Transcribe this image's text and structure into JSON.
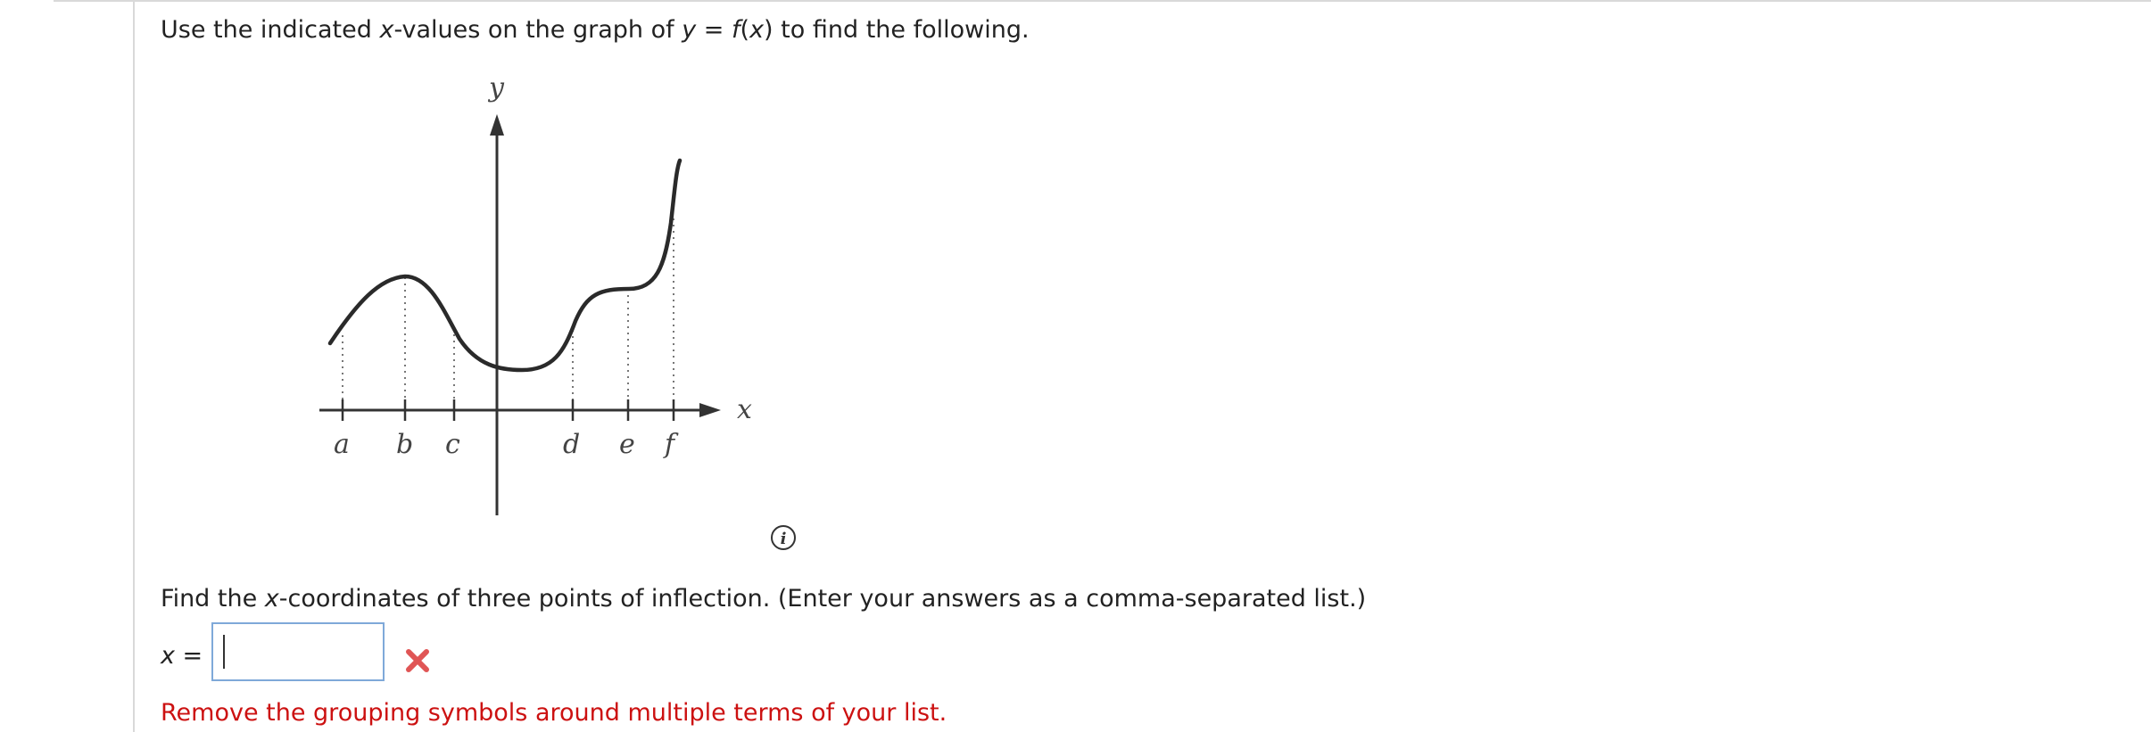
{
  "question": {
    "p1": "Use the indicated ",
    "x": "x",
    "p2": "-values on the graph of ",
    "y": "y",
    "eq": " = ",
    "f": "f",
    "p3": "(",
    "xx": "x",
    "p4": ") to find the following."
  },
  "graph": {
    "axis_y": "y",
    "axis_x": "x",
    "tick_labels": [
      "a",
      "b",
      "c",
      "d",
      "e",
      "f"
    ]
  },
  "info_icon": "info-icon",
  "prompt": {
    "p1": "Find the ",
    "x": "x",
    "p2": "-coordinates of three points of inflection. (Enter your answers as a comma-separated list.)"
  },
  "answer": {
    "label": "x =",
    "value": "",
    "placeholder": ""
  },
  "status_icon": "x-mark-icon",
  "error_message": "Remove the grouping symbols around multiple terms of your list.",
  "colors": {
    "error": "#cc1111",
    "wrong_mark": "#e05555",
    "input_border": "#7fa9d9"
  }
}
